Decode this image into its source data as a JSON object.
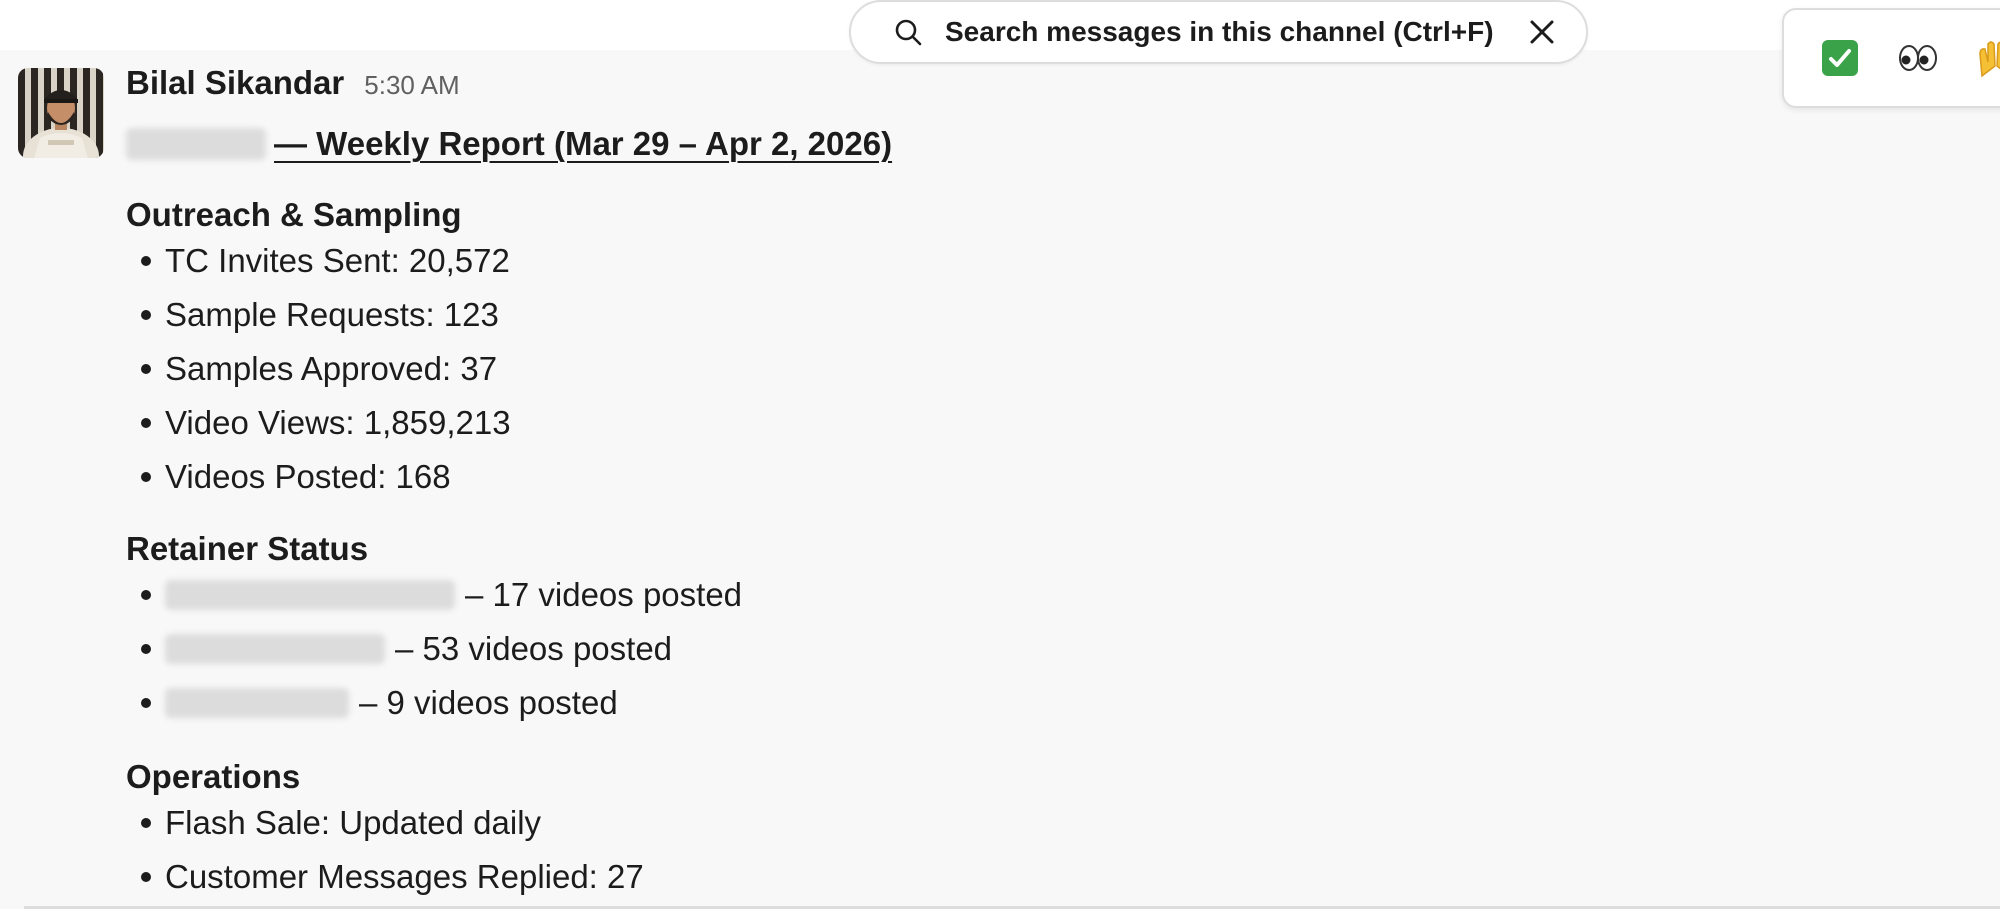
{
  "search": {
    "placeholder": "Search messages in this channel (Ctrl+F)"
  },
  "reactions": [
    {
      "name": "white-check-mark"
    },
    {
      "name": "eyes",
      "glyph": "👀"
    },
    {
      "name": "raised-hands",
      "glyph": "🙌"
    }
  ],
  "message": {
    "sender": "Bilal Sikandar",
    "time": "5:30 AM",
    "title": "— Weekly Report (Mar 29 – Apr 2, 2026)",
    "sections": [
      {
        "heading": "Outreach & Sampling",
        "items": [
          "TC Invites Sent: 20,572",
          "Sample Requests: 123",
          "Samples Approved: 37",
          "Video Views: 1,859,213",
          "Videos Posted: 168"
        ]
      },
      {
        "heading": "Retainer Status",
        "items": [
          "– 17 videos posted",
          "– 53 videos posted",
          "– 9 videos posted"
        ]
      },
      {
        "heading": "Operations",
        "items": [
          "Flash Sale: Updated daily",
          "Customer Messages Replied: 27"
        ]
      }
    ]
  }
}
